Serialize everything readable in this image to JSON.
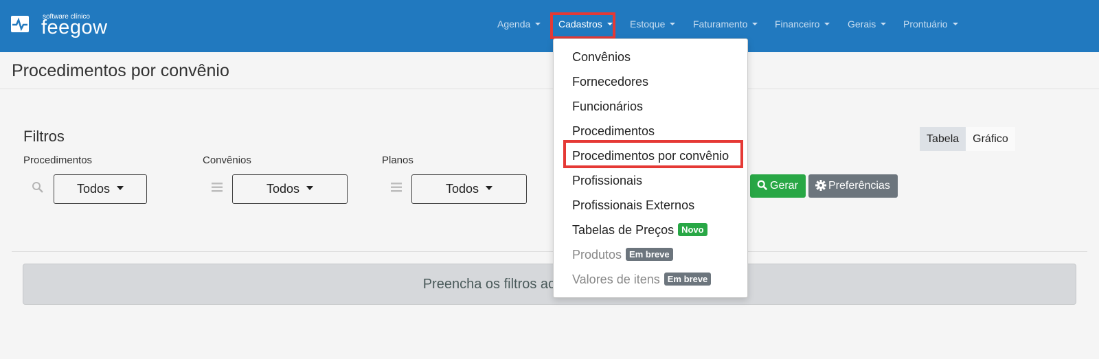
{
  "brand": {
    "name": "feegow",
    "tagline": "software clínico"
  },
  "nav": {
    "items": [
      {
        "label": "Agenda"
      },
      {
        "label": "Cadastros"
      },
      {
        "label": "Estoque"
      },
      {
        "label": "Faturamento"
      },
      {
        "label": "Financeiro"
      },
      {
        "label": "Gerais"
      },
      {
        "label": "Prontuário"
      }
    ],
    "active": "Cadastros"
  },
  "page": {
    "title": "Procedimentos por convênio"
  },
  "filters": {
    "title": "Filtros",
    "procedimentos": {
      "label": "Procedimentos",
      "value": "Todos"
    },
    "convenios": {
      "label": "Convênios",
      "value": "Todos"
    },
    "planos": {
      "label": "Planos",
      "value": "Todos"
    }
  },
  "view_toggle": {
    "table": "Tabela",
    "chart": "Gráfico",
    "selected": "Tabela"
  },
  "actions": {
    "generate": "Gerar",
    "preferences": "Preferências"
  },
  "alert": {
    "text": "Preencha os filtros acima"
  },
  "dropdown": {
    "items": [
      {
        "label": "Convênios"
      },
      {
        "label": "Fornecedores"
      },
      {
        "label": "Funcionários"
      },
      {
        "label": "Procedimentos"
      },
      {
        "label": "Procedimentos por convênio"
      },
      {
        "label": "Profissionais"
      },
      {
        "label": "Profissionais Externos"
      },
      {
        "label": "Tabelas de Preços",
        "badge": "Novo"
      },
      {
        "label": "Produtos",
        "badge": "Em breve"
      },
      {
        "label": "Valores de itens",
        "badge": "Em breve"
      }
    ]
  },
  "colors": {
    "navbar": "#2179bf",
    "highlight": "#e53935",
    "success": "#28a745",
    "secondary": "#6c757d"
  },
  "icons": [
    "search-icon",
    "bars-icon",
    "gear-icon",
    "caret-down-icon",
    "logo-icon"
  ]
}
